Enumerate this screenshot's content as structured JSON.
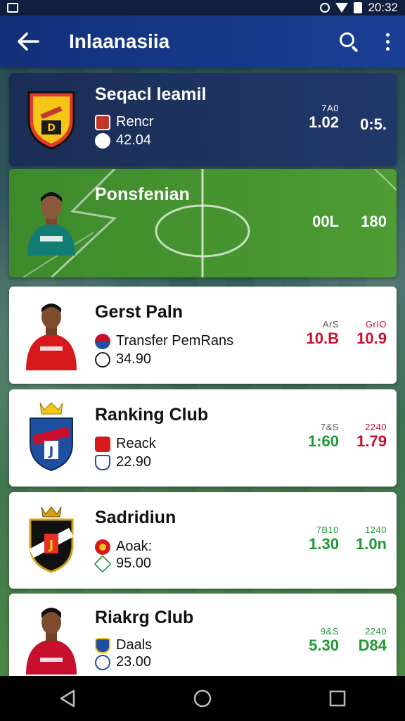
{
  "status_bar": {
    "time": "20:32"
  },
  "app_bar": {
    "title": "Inlaanasiia",
    "back_icon": "arrow-left-icon",
    "search_icon": "search-icon",
    "more_icon": "more-vert-icon"
  },
  "cards": [
    {
      "title": "Seqacl leamil",
      "sub_label": "Rencr",
      "sub_value": "42.04",
      "odds": [
        {
          "label": "7A0",
          "value": "1.02"
        },
        {
          "label": "",
          "value": "0:5."
        }
      ]
    },
    {
      "title": "Ponsfenian",
      "odds": [
        {
          "label": "",
          "value": "00L"
        },
        {
          "label": "",
          "value": "180"
        }
      ]
    },
    {
      "title": "Gerst Paln",
      "sub_label": "Transfer PemRans",
      "sub_value": "34.90",
      "odds": [
        {
          "label": "ArS",
          "value": "10.B"
        },
        {
          "label": "GrIO",
          "value": "10.9"
        }
      ]
    },
    {
      "title": "Ranking Club",
      "sub_label": "Reack",
      "sub_value": "22.90",
      "odds": [
        {
          "label": "7&S",
          "value": "1:60"
        },
        {
          "label": "2240",
          "value": "1.79"
        }
      ]
    },
    {
      "title": "Sadridiun",
      "sub_label": "Aoak:",
      "sub_value": "95.00",
      "odds": [
        {
          "label": "7B10",
          "value": "1.30"
        },
        {
          "label": "1240",
          "value": "1.0n"
        }
      ]
    },
    {
      "title": "Riakrg Club",
      "sub_label": "Daals",
      "sub_value": "23.00",
      "odds": [
        {
          "label": "9&S",
          "value": "5.30"
        },
        {
          "label": "2240",
          "value": "D84"
        }
      ]
    }
  ],
  "colors": {
    "app_bar": "#1a3f95",
    "odds_red": "#c8102e",
    "odds_green": "#1e9a35",
    "pitch_green": "#4e9c33"
  },
  "nav": {
    "back": "nav-back-icon",
    "home": "nav-home-icon",
    "recents": "nav-recents-icon"
  }
}
